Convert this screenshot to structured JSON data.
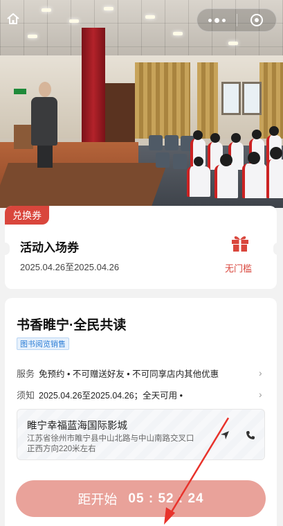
{
  "voucher": {
    "tag": "兑换券",
    "title": "活动入场券",
    "date_range": "2025.04.26至2025.04.26",
    "threshold": "无门槛",
    "icon": "gift-icon"
  },
  "event": {
    "title": "书香睢宁·全民共读",
    "category_tag": "图书阅览销售",
    "service_label": "服务",
    "service_value": "免预约 • 不可赠送好友 • 不可同享店内其他优惠",
    "notice_label": "须知",
    "notice_value": "2025.04.26至2025.04.26；全天可用 •"
  },
  "venue": {
    "name": "睢宁幸福蓝海国际影城",
    "address": "江苏省徐州市睢宁县中山北路与中山南路交叉口正西方向220米左右",
    "navigate_icon": "navigate-icon",
    "phone_icon": "phone-icon"
  },
  "countdown": {
    "label": "距开始",
    "time": "05 : 52 : 24"
  },
  "colors": {
    "accent_red": "#d9463c",
    "button_bg": "#e9a29a",
    "tag_blue": "#2e7fd6",
    "annotation_arrow": "#e8322b"
  },
  "nav": {
    "home_icon": "home-icon",
    "more_icon": "more-dots-icon",
    "close_icon": "close-miniprogram-icon"
  }
}
